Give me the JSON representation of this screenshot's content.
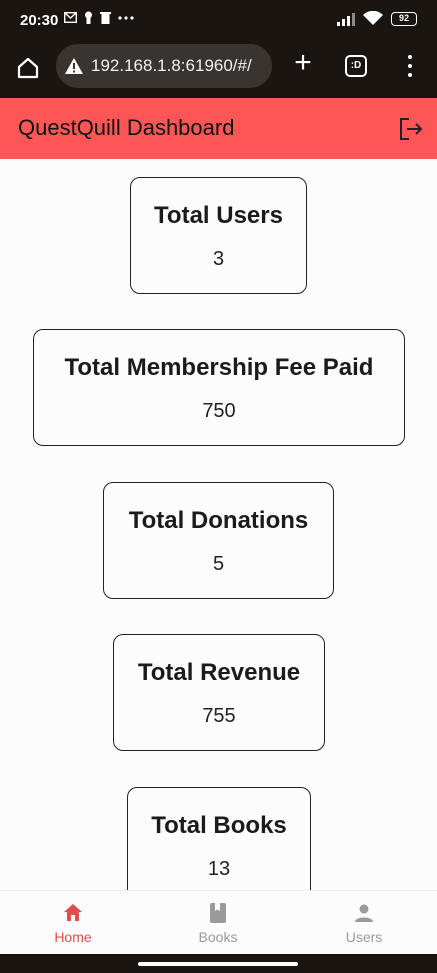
{
  "status_bar": {
    "time": "20:30",
    "battery": "92",
    "icons": [
      "mail-icon",
      "keyhole-icon",
      "trash-icon",
      "more-dots-icon",
      "signal-icon",
      "wifi-icon",
      "battery-icon"
    ]
  },
  "browser": {
    "url": "192.168.1.8:61960/#/",
    "tabs_label": ":D"
  },
  "app_bar": {
    "title": "QuestQuill Dashboard"
  },
  "cards": [
    {
      "title": "Total Users",
      "value": "3"
    },
    {
      "title": "Total Membership Fee Paid",
      "value": "750"
    },
    {
      "title": "Total Donations",
      "value": "5"
    },
    {
      "title": "Total Revenue",
      "value": "755"
    },
    {
      "title": "Total Books",
      "value": "13"
    }
  ],
  "bottom_nav": {
    "items": [
      {
        "label": "Home",
        "icon": "home-icon",
        "active": true
      },
      {
        "label": "Books",
        "icon": "book-icon",
        "active": false
      },
      {
        "label": "Users",
        "icon": "person-icon",
        "active": false
      }
    ]
  },
  "colors": {
    "accent": "#fe5656",
    "active_nav": "#e34c4c",
    "inactive_nav": "#9a9a9a",
    "browser_bg": "#1b1511"
  }
}
